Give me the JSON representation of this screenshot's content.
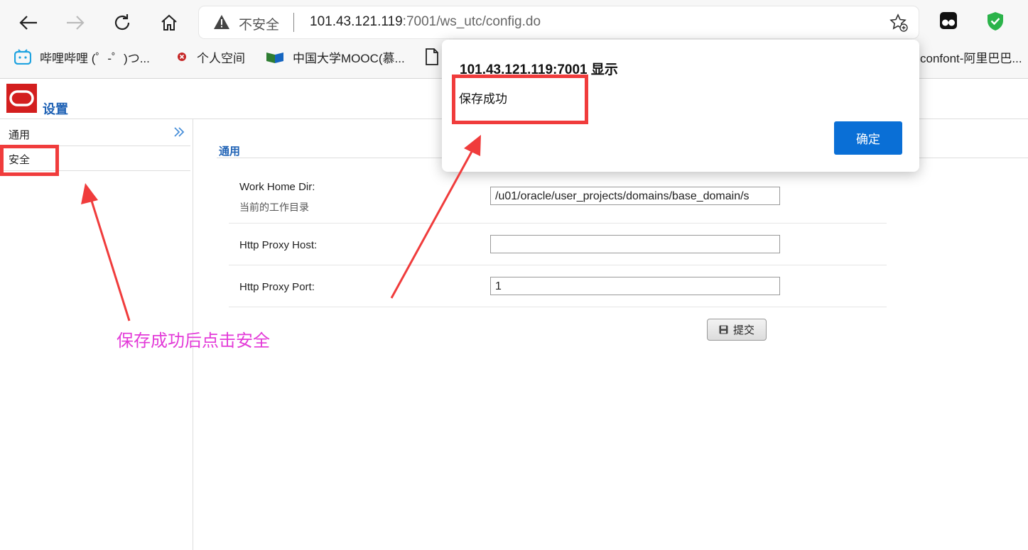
{
  "browser": {
    "security_label": "不安全",
    "url_host": "101.43.121.119",
    "url_rest": ":7001/ws_utc/config.do",
    "bookmarks": [
      {
        "label": "哔哩哔哩 (゜-゜)つ...",
        "icon": "bilibili-icon"
      },
      {
        "label": "个人空间",
        "icon": "profile-icon"
      },
      {
        "label": "中国大学MOOC(慕...",
        "icon": "mooc-icon"
      },
      {
        "label": "",
        "icon": "page-icon"
      },
      {
        "label": "confont-阿里巴巴...",
        "icon": "iconfont-icon"
      }
    ]
  },
  "app": {
    "title": "设置",
    "sidebar": [
      {
        "label": "通用"
      },
      {
        "label": "安全"
      }
    ],
    "section_title": "通用",
    "fields": [
      {
        "label": "Work Home Dir:",
        "sub": "当前的工作目录",
        "value": "/u01/oracle/user_projects/domains/base_domain/s"
      },
      {
        "label": "Http Proxy Host:",
        "value": ""
      },
      {
        "label": "Http Proxy Port:",
        "value": "1"
      }
    ],
    "submit_label": "提交"
  },
  "dialog": {
    "title": "101.43.121.119:7001 显示",
    "message": "保存成功",
    "ok_label": "确定"
  },
  "annotation": {
    "text": "保存成功后点击安全",
    "color": "#e33ad8",
    "box_color": "#f03c3c"
  }
}
